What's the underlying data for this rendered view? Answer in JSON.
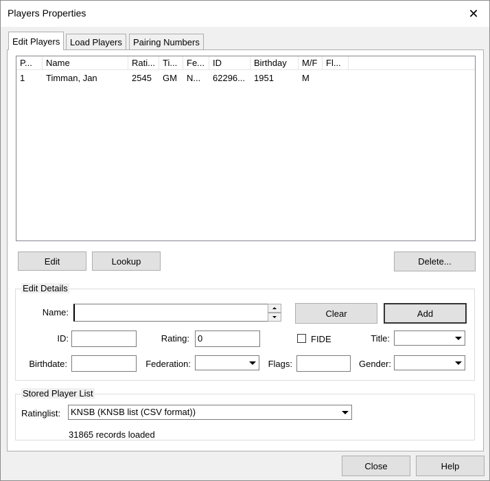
{
  "window": {
    "title": "Players Properties"
  },
  "tabs": [
    {
      "label": "Edit Players"
    },
    {
      "label": "Load Players"
    },
    {
      "label": "Pairing Numbers"
    }
  ],
  "player_list": {
    "columns": [
      "P...",
      "Name",
      "Rati...",
      "Ti...",
      "Fe...",
      "ID",
      "Birthday",
      "M/F",
      "Fl..."
    ],
    "rows": [
      [
        "1",
        "Timman, Jan",
        "2545",
        "GM",
        "N...",
        "62296...",
        "1951",
        "M",
        ""
      ]
    ]
  },
  "list_buttons": {
    "edit": "Edit",
    "lookup": "Lookup",
    "delete": "Delete..."
  },
  "edit_details": {
    "legend": "Edit Details",
    "name_label": "Name:",
    "name_value": "",
    "clear_button": "Clear",
    "add_button": "Add",
    "id_label": "ID:",
    "id_value": "",
    "rating_label": "Rating:",
    "rating_value": "0",
    "fide_label": "FIDE",
    "title_label": "Title:",
    "title_value": "",
    "birthdate_label": "Birthdate:",
    "birthdate_value": "",
    "federation_label": "Federation:",
    "federation_value": "",
    "flags_label": "Flags:",
    "flags_value": "",
    "gender_label": "Gender:",
    "gender_value": ""
  },
  "stored_list": {
    "legend": "Stored Player List",
    "ratinglist_label": "Ratinglist:",
    "ratinglist_value": "KNSB (KNSB list (CSV format))",
    "status": "31865 records loaded"
  },
  "footer": {
    "close": "Close",
    "help": "Help"
  }
}
